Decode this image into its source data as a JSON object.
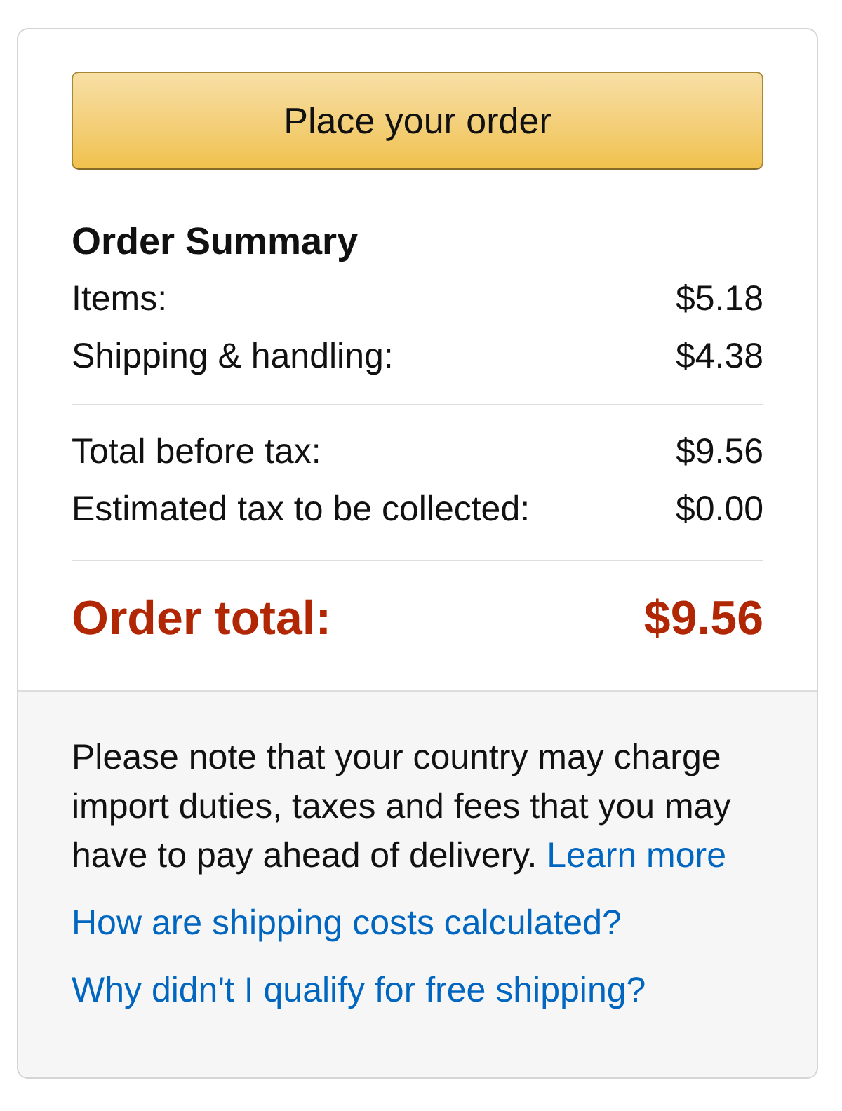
{
  "place_order_button": {
    "label": "Place your order"
  },
  "order_summary": {
    "title": "Order Summary",
    "sections": [
      {
        "lines": [
          {
            "label": "Items:",
            "amount": "$5.18"
          },
          {
            "label": "Shipping & handling:",
            "amount": "$4.38"
          }
        ]
      },
      {
        "lines": [
          {
            "label": "Total before tax:",
            "amount": "$9.56"
          },
          {
            "label": "Estimated tax to be collected:",
            "amount": "$0.00"
          }
        ]
      }
    ],
    "total": {
      "label": "Order total:",
      "amount": "$9.56"
    }
  },
  "notice": {
    "text": "Please note that your country may charge import duties, taxes and fees that you may have to pay ahead of delivery.",
    "link": "Learn more"
  },
  "help_links": [
    "How are shipping costs calculated?",
    "Why didn't I qualify for free shipping?"
  ]
}
